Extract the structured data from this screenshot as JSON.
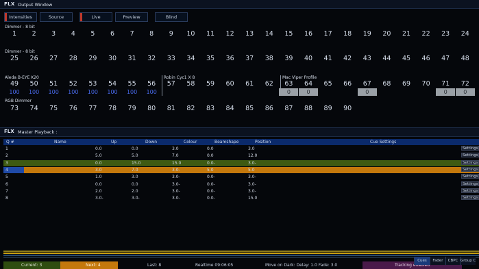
{
  "output_window": {
    "logo": "FLX",
    "title": "Output Window",
    "tabs": [
      {
        "label": "Intensities",
        "mark": "#c0392b"
      },
      {
        "label": "Source",
        "mark": ""
      },
      {
        "label": "Live",
        "mark": "#c0392b"
      },
      {
        "label": "Preview",
        "mark": ""
      },
      {
        "label": "Blind",
        "mark": ""
      }
    ],
    "groups": {
      "dimmer1": "Dimmer - 8 bit",
      "dimmer2": "Dimmer - 8 bit",
      "aleda": "Aleda B-EYE K20",
      "robin": "Robin Cyc1 X 8",
      "viper": "Mac Viper Profile",
      "rgb": "RGB Dimmer"
    },
    "row1": [
      "1",
      "2",
      "3",
      "4",
      "5",
      "6",
      "7",
      "8",
      "9",
      "10",
      "11",
      "12",
      "13",
      "14",
      "15",
      "16",
      "17",
      "18",
      "19",
      "20",
      "21",
      "22",
      "23",
      "24"
    ],
    "row2": [
      "25",
      "26",
      "27",
      "28",
      "29",
      "30",
      "31",
      "32",
      "33",
      "34",
      "35",
      "36",
      "37",
      "38",
      "39",
      "40",
      "41",
      "42",
      "43",
      "44",
      "45",
      "46",
      "47",
      "48"
    ],
    "row3": [
      "49",
      "50",
      "51",
      "52",
      "53",
      "54",
      "55",
      "56",
      "57",
      "58",
      "59",
      "60",
      "61",
      "62",
      "63",
      "64",
      "65",
      "66",
      "67",
      "68",
      "69",
      "70",
      "71",
      "72"
    ],
    "row3_values": [
      "100",
      "100",
      "100",
      "100",
      "100",
      "100",
      "100",
      "100",
      "",
      "",
      "",
      "",
      "",
      "",
      "0",
      "0",
      "",
      "",
      "0",
      "",
      "",
      "",
      "0",
      "0"
    ],
    "row4": [
      "73",
      "74",
      "75",
      "76",
      "77",
      "78",
      "79",
      "80",
      "81",
      "82",
      "83",
      "84",
      "85",
      "86",
      "87",
      "88",
      "89",
      "90"
    ]
  },
  "master_playback": {
    "logo": "FLX",
    "title": "Master Playback :",
    "columns": [
      "Q #",
      "Name",
      "Up",
      "Down",
      "Colour",
      "Beamshape",
      "Position",
      "Cue Settings"
    ],
    "rows": [
      {
        "q": "1",
        "up": "0.0",
        "down": "0.0",
        "colour": "3.0",
        "beam": "0.0",
        "pos": "3.0",
        "settings": "Settings"
      },
      {
        "q": "2",
        "up": "5.0",
        "down": "5.0",
        "colour": "7.0",
        "beam": "0.0",
        "pos": "12.0",
        "settings": "Settings"
      },
      {
        "q": "3",
        "up": "0.0",
        "down": "15.0",
        "colour": "15.0",
        "beam": "0.0-",
        "pos": "3.0-",
        "settings": "Settings"
      },
      {
        "q": "4",
        "up": "3.0",
        "down": "7.0",
        "colour": "3.0-",
        "beam": "5.0",
        "pos": "5.0",
        "settings": "Settings"
      },
      {
        "q": "5",
        "up": "1.0",
        "down": "3.0",
        "colour": "3.0-",
        "beam": "0.0-",
        "pos": "3.0-",
        "settings": "Settings"
      },
      {
        "q": "6",
        "up": "0.0",
        "down": "0.0",
        "colour": "3.0-",
        "beam": "0.0-",
        "pos": "3.0-",
        "settings": "Settings"
      },
      {
        "q": "7",
        "up": "2.0",
        "down": "2.0",
        "colour": "3.0-",
        "beam": "0.0-",
        "pos": "3.0-",
        "settings": "Settings"
      },
      {
        "q": "8",
        "up": "3.0-",
        "down": "3.0-",
        "colour": "3.0-",
        "beam": "0.0-",
        "pos": "15.0",
        "settings": "Settings"
      }
    ],
    "row_colors": [
      "",
      "",
      "#3e5a12",
      "#c4780c",
      "",
      "",
      "",
      ""
    ],
    "status": {
      "current": "Current: 3",
      "next": "Next: 4",
      "last": "Last: 8",
      "realtime": "Realtime 09:06:05",
      "move_on_dark": "Move on Dark: Delay: 1.0  Fade: 3.0",
      "tracking": "Tracking enabled"
    },
    "bottom_tabs": [
      "Cues",
      "Fader",
      "CBPC",
      "Group Cues"
    ]
  }
}
